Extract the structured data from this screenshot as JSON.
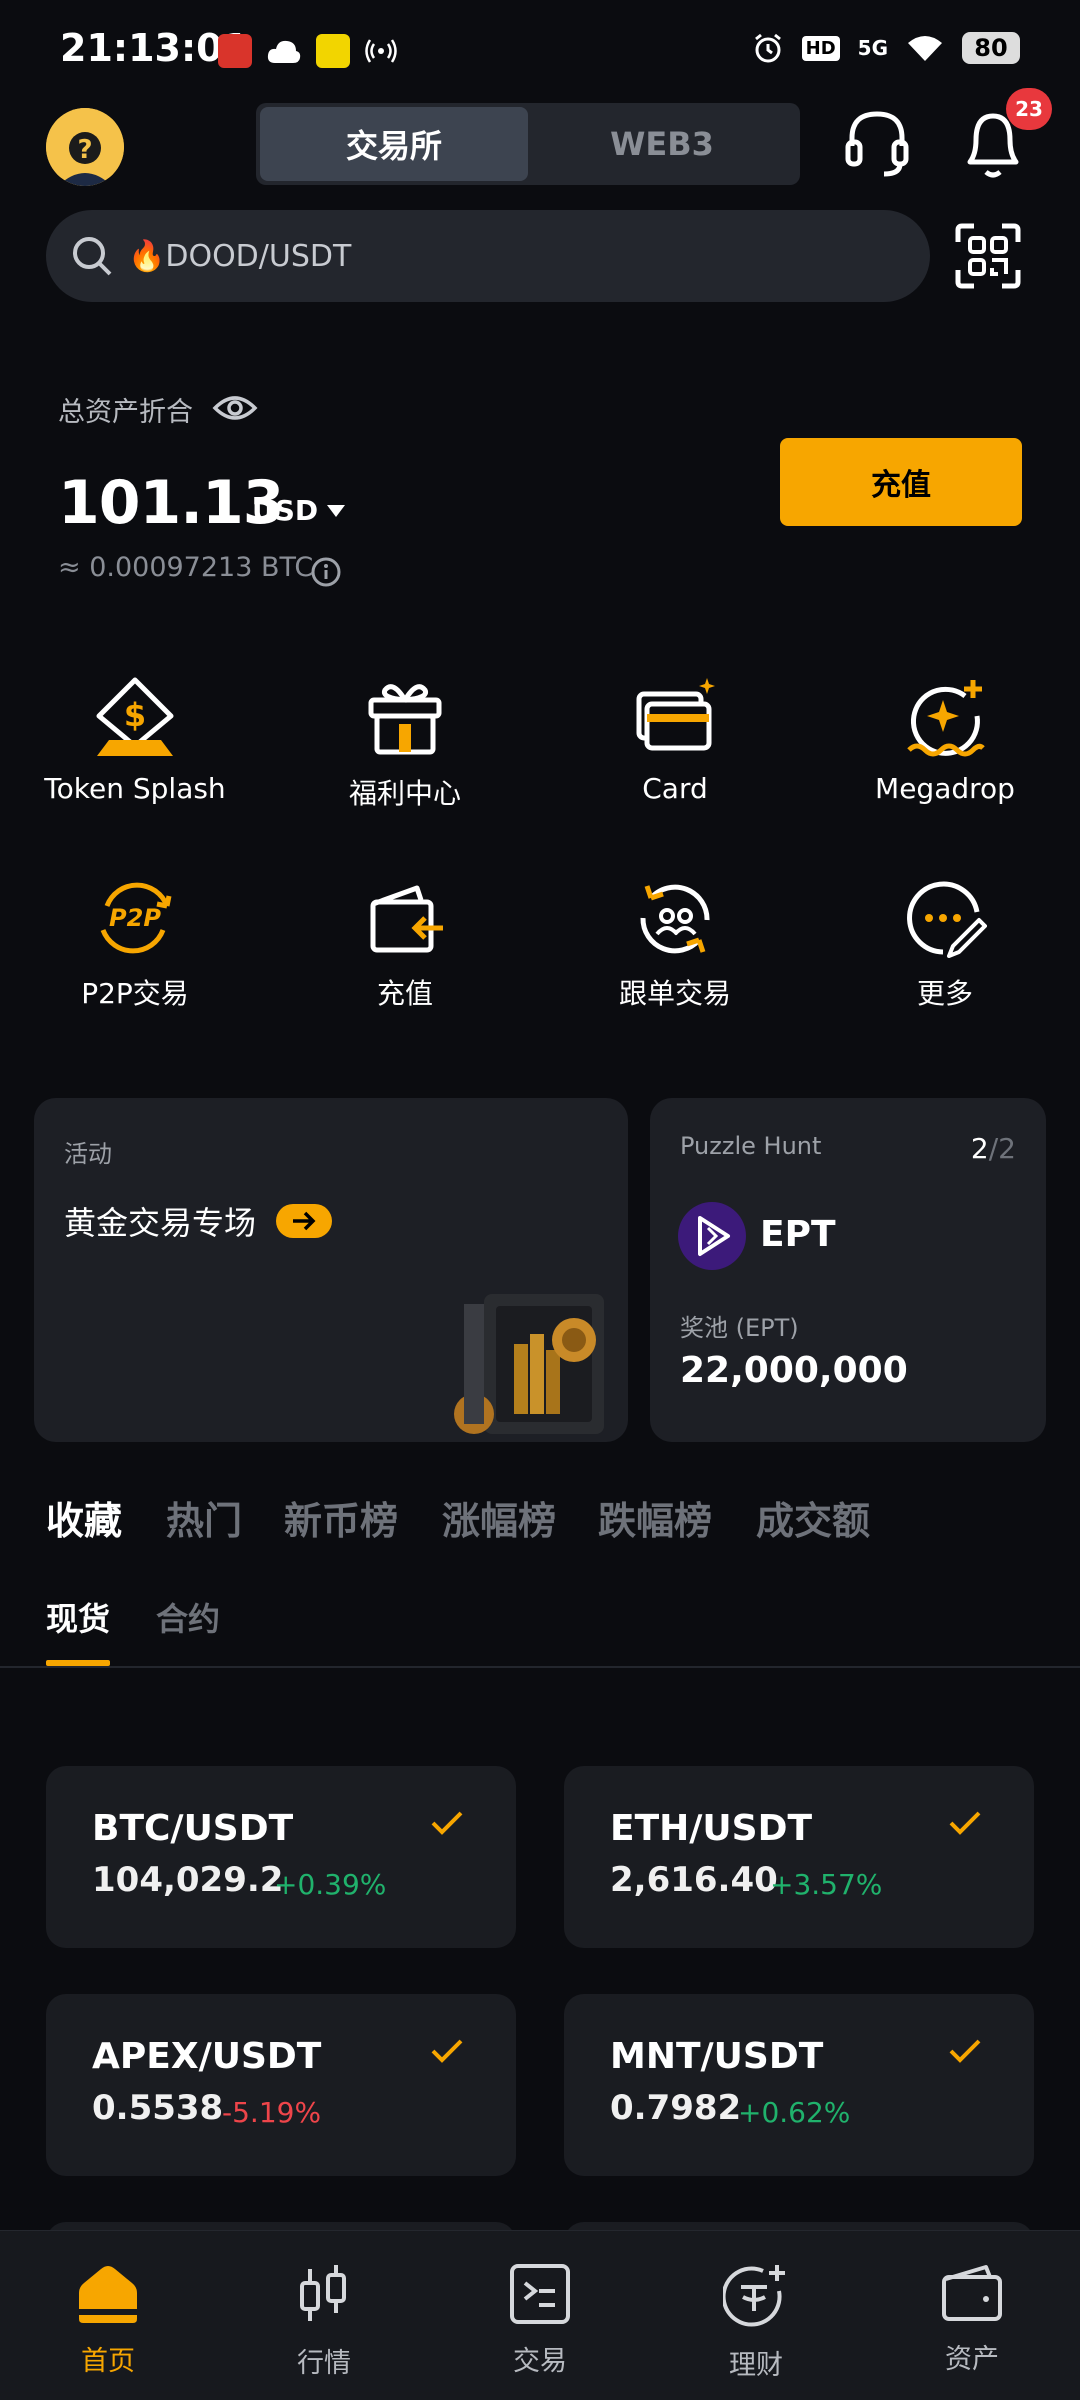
{
  "status_bar": {
    "time": "21:13:01",
    "battery": "80",
    "network": "5G",
    "hd": "HD"
  },
  "header": {
    "segments": [
      {
        "label": "交易所",
        "active": true
      },
      {
        "label": "WEB3",
        "active": false
      }
    ],
    "notification_count": "23"
  },
  "search": {
    "placeholder": "DOOD/USDT",
    "fire_icon": "🔥"
  },
  "assets": {
    "label": "总资产折合",
    "balance": "101.13",
    "currency": "USD",
    "btc_equivalent": "≈ 0.00097213 BTC",
    "deposit_label": "充值"
  },
  "quick_actions": [
    {
      "label": "Token Splash",
      "icon": "diamond-dollar-icon"
    },
    {
      "label": "福利中心",
      "icon": "gift-icon"
    },
    {
      "label": "Card",
      "icon": "card-icon"
    },
    {
      "label": "Megadrop",
      "icon": "megadrop-icon"
    },
    {
      "label": "P2P交易",
      "icon": "p2p-icon"
    },
    {
      "label": "充值",
      "icon": "deposit-icon"
    },
    {
      "label": "跟单交易",
      "icon": "copy-trade-icon"
    },
    {
      "label": "更多",
      "icon": "more-icon"
    }
  ],
  "activity_card": {
    "tag": "活动",
    "title": "黄金交易专场"
  },
  "puzzle_card": {
    "title": "Puzzle Hunt",
    "page_current": "2",
    "page_total": "/2",
    "token": "EPT",
    "pool_label": "奖池 (EPT)",
    "pool_amount": "22,000,000"
  },
  "market_tabs": [
    "收藏",
    "热门",
    "新币榜",
    "涨幅榜",
    "跌幅榜",
    "成交额"
  ],
  "market_sub_tabs": [
    "现货",
    "合约"
  ],
  "pairs": [
    {
      "name": "BTC/USDT",
      "price": "104,029.2",
      "change": "+0.39%",
      "direction": "up"
    },
    {
      "name": "ETH/USDT",
      "price": "2,616.40",
      "change": "+3.57%",
      "direction": "up"
    },
    {
      "name": "APEX/USDT",
      "price": "0.5538",
      "change": "-5.19%",
      "direction": "down"
    },
    {
      "name": "MNT/USDT",
      "price": "0.7982",
      "change": "+0.62%",
      "direction": "up"
    }
  ],
  "bottom_nav": [
    {
      "label": "首页",
      "active": true
    },
    {
      "label": "行情",
      "active": false
    },
    {
      "label": "交易",
      "active": false
    },
    {
      "label": "理财",
      "active": false
    },
    {
      "label": "资产",
      "active": false
    }
  ],
  "colors": {
    "accent": "#f7a600",
    "background": "#0b0c10",
    "up": "#20b26c",
    "down": "#ef454a"
  }
}
